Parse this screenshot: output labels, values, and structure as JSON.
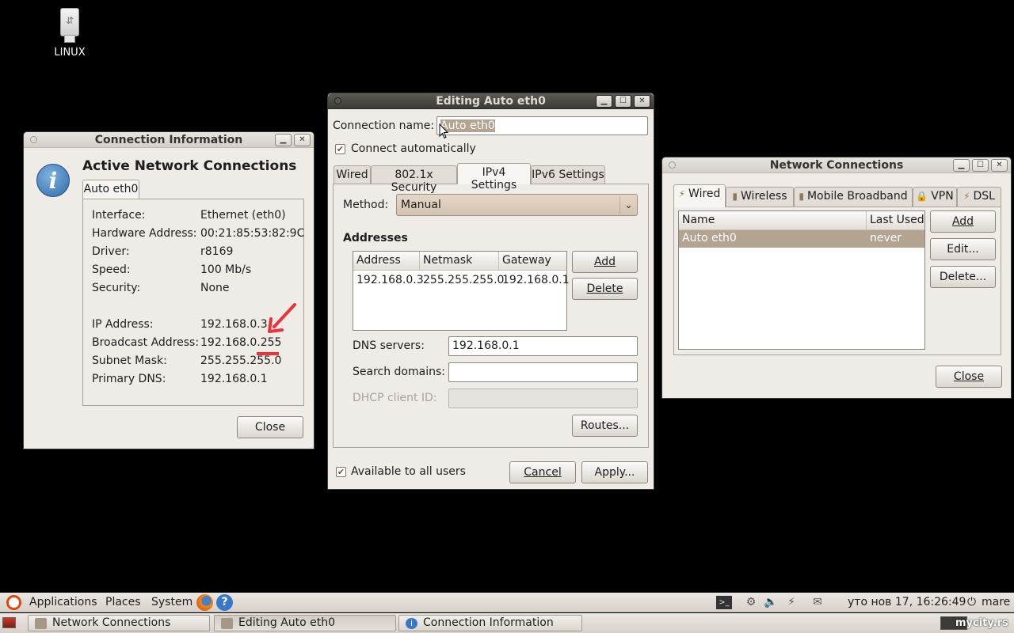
{
  "desktop": {
    "icon_label": "LINUX"
  },
  "conn_info": {
    "title": "Connection Information",
    "heading": "Active Network Connections",
    "tab": "Auto eth0",
    "rows": [
      {
        "k": "Interface:",
        "v": "Ethernet (eth0)"
      },
      {
        "k": "Hardware Address:",
        "v": "00:21:85:53:82:9C"
      },
      {
        "k": "Driver:",
        "v": "r8169"
      },
      {
        "k": "Speed:",
        "v": "100 Mb/s"
      },
      {
        "k": "Security:",
        "v": "None"
      },
      {
        "k": "IP Address:",
        "v": "192.168.0.3"
      },
      {
        "k": "Broadcast Address:",
        "v": "192.168.0.255"
      },
      {
        "k": "Subnet Mask:",
        "v": "255.255.255.0"
      },
      {
        "k": "Primary DNS:",
        "v": "192.168.0.1"
      }
    ],
    "close": "Close"
  },
  "editing": {
    "title": "Editing Auto eth0",
    "conn_name_label": "Connection name:",
    "conn_name_value": "Auto eth0",
    "connect_auto": "Connect automatically",
    "tabs": [
      "Wired",
      "802.1x Security",
      "IPv4 Settings",
      "IPv6 Settings"
    ],
    "method_label": "Method:",
    "method_value": "Manual",
    "addresses_heading": "Addresses",
    "addr_cols": [
      "Address",
      "Netmask",
      "Gateway"
    ],
    "addr_row": [
      "192.168.0.3",
      "255.255.255.0",
      "192.168.0.1"
    ],
    "add": "Add",
    "delete": "Delete",
    "dns_label": "DNS servers:",
    "dns_value": "192.168.0.1",
    "search_label": "Search domains:",
    "search_value": "",
    "dhcp_label": "DHCP client ID:",
    "routes": "Routes...",
    "available_all": "Available to all users",
    "cancel": "Cancel",
    "apply": "Apply..."
  },
  "netconn": {
    "title": "Network Connections",
    "tabs": [
      "Wired",
      "Wireless",
      "Mobile Broadband",
      "VPN",
      "DSL"
    ],
    "cols": [
      "Name",
      "Last Used"
    ],
    "row": [
      "Auto eth0",
      "never"
    ],
    "add": "Add",
    "edit": "Edit...",
    "delete": "Delete...",
    "close": "Close"
  },
  "panel": {
    "applications": "Applications",
    "places": "Places",
    "system": "System",
    "clock": "уто нов 17, 16:26:49",
    "user": "mare",
    "tasks": [
      "Network Connections",
      "Editing Auto eth0",
      "Connection Information"
    ],
    "watermark": "mycity.rs"
  },
  "colors": {
    "annotation": "#e8333b",
    "selection": "#b3a390",
    "ubuntu_orange": "#dd4814"
  }
}
